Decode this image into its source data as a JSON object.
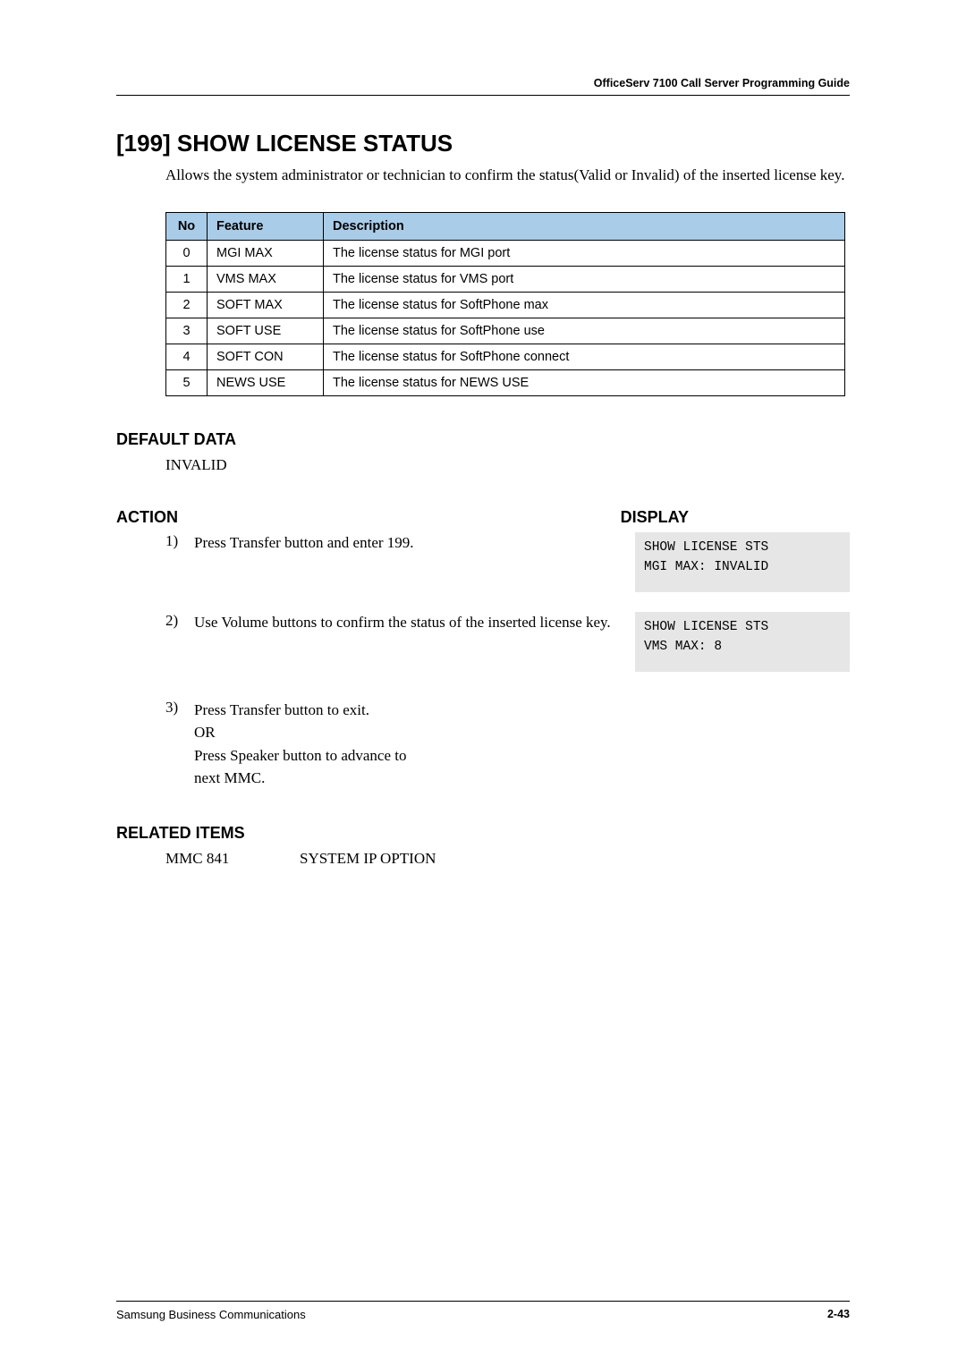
{
  "header": {
    "doc_title": "OfficeServ 7100 Call Server Programming Guide"
  },
  "section": {
    "title": "[199] SHOW LICENSE STATUS",
    "intro": "Allows the system administrator or technician to confirm the status(Valid or Invalid) of the inserted license key."
  },
  "table": {
    "headers": {
      "no": "No",
      "feature": "Feature",
      "description": "Description"
    },
    "rows": [
      {
        "no": "0",
        "feature": "MGI MAX",
        "description": "The license status for MGI port"
      },
      {
        "no": "1",
        "feature": "VMS MAX",
        "description": "The license status for VMS port"
      },
      {
        "no": "2",
        "feature": "SOFT MAX",
        "description": "The license status for SoftPhone max"
      },
      {
        "no": "3",
        "feature": "SOFT USE",
        "description": "The license status for SoftPhone use"
      },
      {
        "no": "4",
        "feature": "SOFT CON",
        "description": "The license status for SoftPhone connect"
      },
      {
        "no": "5",
        "feature": "NEWS USE",
        "description": "The license status for NEWS USE"
      }
    ]
  },
  "default_data": {
    "heading": "DEFAULT DATA",
    "value": "INVALID"
  },
  "action_display": {
    "action_heading": "ACTION",
    "display_heading": "DISPLAY"
  },
  "steps": [
    {
      "num": "1)",
      "text": "Press Transfer button and enter 199.",
      "display": "SHOW LICENSE STS\nMGI MAX: INVALID"
    },
    {
      "num": "2)",
      "text": "Use Volume buttons to confirm the status of the inserted license key.",
      "display": "SHOW LICENSE STS\nVMS MAX: 8"
    },
    {
      "num": "3)",
      "text_lines": [
        "Press Transfer button to exit.",
        "OR",
        "Press Speaker button to advance to",
        "next MMC."
      ]
    }
  ],
  "related": {
    "heading": "RELATED ITEMS",
    "code": "MMC 841",
    "label": "SYSTEM IP OPTION"
  },
  "footer": {
    "left": "Samsung Business Communications",
    "page": "2-43"
  }
}
